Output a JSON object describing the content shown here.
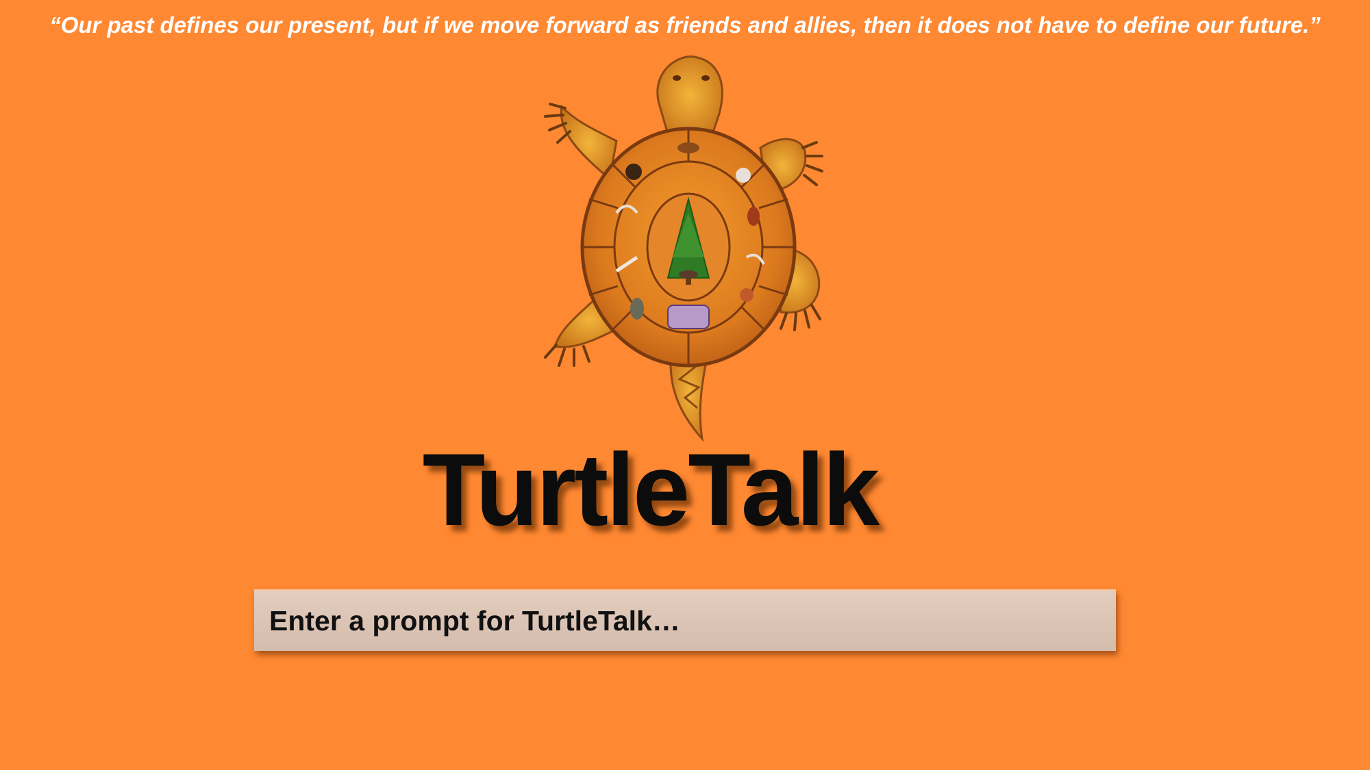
{
  "header": {
    "quote": "“Our past defines our present, but if we move forward as friends and allies, then it does not have to define our future.”"
  },
  "logo": {
    "icon": "turtle-clan-icon",
    "colors": {
      "shell": "#d7781e",
      "shell_edge": "#7a3a10",
      "body": "#e0961e",
      "tree": "#2f7a24"
    }
  },
  "main": {
    "title": "TurtleTalk"
  },
  "prompt": {
    "placeholder": "Enter a prompt for TurtleTalk…",
    "value": ""
  },
  "theme": {
    "background": "#ff8832",
    "input_background": "#d9c2b3"
  }
}
